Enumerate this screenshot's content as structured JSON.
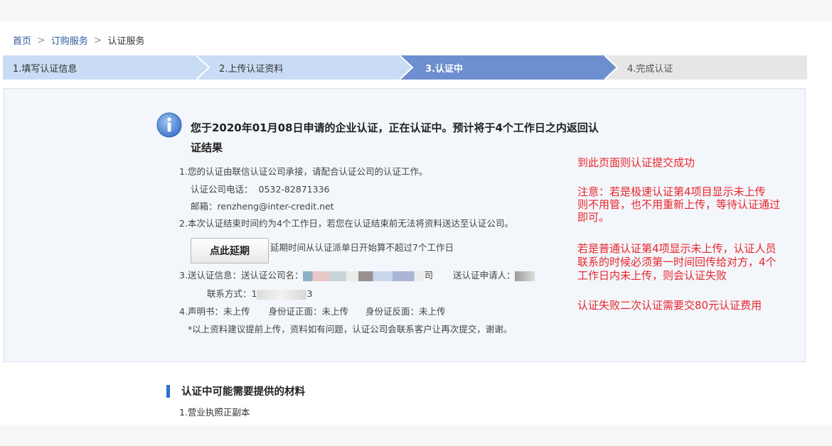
{
  "breadcrumb": {
    "home": "首页",
    "order": "订购服务",
    "current": "认证服务",
    "separator": ">"
  },
  "steps": [
    {
      "label": "1.填写认证信息",
      "color": "#c9dcf5"
    },
    {
      "label": "2.上传认证资料",
      "color": "#c9dcf5"
    },
    {
      "label": "3.认证中",
      "color": "#6d8fcf"
    },
    {
      "label": "4.完成认证",
      "color": "#e6e6e6"
    }
  ],
  "status": {
    "headline_line1": "您于2020年01月08日申请的企业认证，正在认证中。预计将于4个工作日之内返回认",
    "headline_line2": "证结果",
    "item1_prefix": "1.",
    "item1_text": "您的认证由联信认证公司承接，请配合认证公司的认证工作。",
    "phone_label": "认证公司电话：",
    "phone_value": "0532-82871336",
    "email_label": "邮箱：",
    "email_value": "renzheng@inter-credit.net",
    "item2_prefix": "2.",
    "item2_text": "本次认证结束时间约为4个工作日，若您在认证结束前无法将资料送达至认证公司。",
    "delay_button": "点此延期",
    "delay_note": "延期时间从认证派单日开始算不超过7个工作日",
    "item3_prefix": "3.",
    "item3_label": "送认证信息：送认证公司名：",
    "item3_name_tail": "司",
    "item3_applicant_label": "送认证申请人：",
    "contact_label": "联系方式：",
    "contact_value_head": "1",
    "contact_value_tail": "3",
    "item4_prefix": "4.",
    "item4_statement": "声明书：未上传",
    "item4_id_front": "身份证正面：未上传",
    "item4_id_back": "身份证反面：未上传",
    "footnote": "*以上资料建议提前上传，资料如有问题，认证公司会联系客户让再次提交，谢谢。"
  },
  "annotation": {
    "line1": "到此页面则认证提交成功",
    "line2": "注意：若是极速认证第4项目显示未上传",
    "line3": "则不用管，也不用重新上传，等待认证通过",
    "line4": "即可。",
    "line5": "若是普通认证第4项显示未上传，认证人员",
    "line6": "联系的时候必须第一时间回传给对方，4个",
    "line7": "工作日内未上传，则会认证失败",
    "line8": "认证失败二次认证需要交80元认证费用",
    "color": "#e8262d"
  },
  "materials": {
    "title": "认证中可能需要提供的材料",
    "item1": "1.营业执照正副本"
  },
  "icons": {
    "info": "info-icon",
    "separator": "chevron-right-icon"
  }
}
